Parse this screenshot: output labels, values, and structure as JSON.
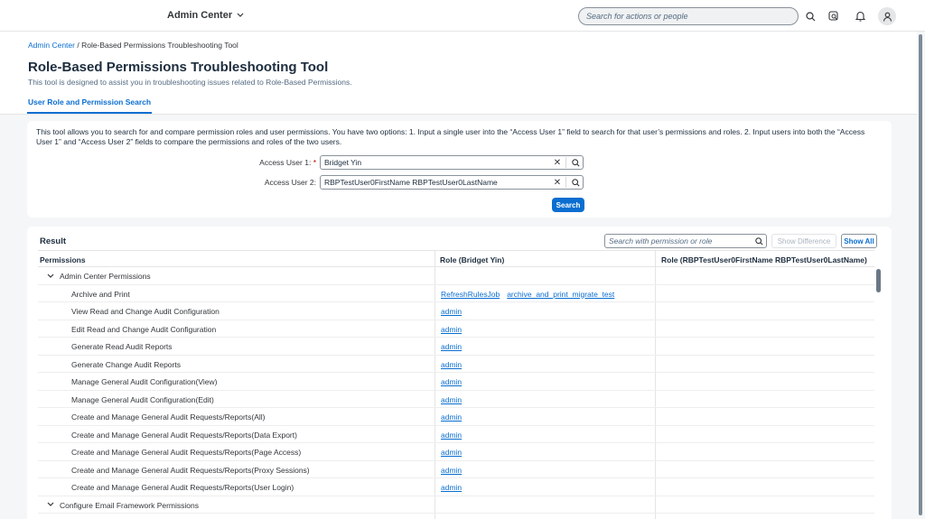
{
  "shell": {
    "title": "Admin Center",
    "search_placeholder": "Search for actions or people"
  },
  "breadcrumb": {
    "root": "Admin Center",
    "current": "Role-Based Permissions Troubleshooting Tool"
  },
  "page": {
    "title": "Role-Based Permissions Troubleshooting Tool",
    "subtitle": "This tool is designed to assist you in troubleshooting issues related to Role-Based Permissions.",
    "tab": "User Role and Permission Search"
  },
  "search_card": {
    "description": "This tool allows you to search for and compare permission roles and user permissions. You have two options: 1. Input a single user into the “Access User 1” field to search for that user’s permissions and roles. 2. Input users into both the “Access User 1” and “Access User 2” fields to compare the permissions and roles of the two users.",
    "user1_label": "Access User 1:",
    "user1_required": "*",
    "user1_value": "Bridget Yin",
    "user2_label": "Access User 2:",
    "user2_value": "RBPTestUser0FirstName RBPTestUser0LastName",
    "search_button": "Search"
  },
  "result": {
    "title": "Result",
    "search_placeholder": "Search with permission or role",
    "show_difference": "Show Difference",
    "show_all": "Show All",
    "columns": [
      "Permissions",
      "Role (Bridget Yin)",
      "Role (RBPTestUser0FirstName RBPTestUser0LastName)"
    ],
    "rows": [
      {
        "type": "group",
        "label": "Admin Center Permissions",
        "roles": []
      },
      {
        "type": "item",
        "label": "Archive and Print",
        "roles": [
          "RefreshRulesJob",
          "archive_and_print_migrate_test"
        ]
      },
      {
        "type": "item",
        "label": "View Read and Change Audit Configuration",
        "roles": [
          "admin"
        ]
      },
      {
        "type": "item",
        "label": "Edit Read and Change Audit Configuration",
        "roles": [
          "admin"
        ]
      },
      {
        "type": "item",
        "label": "Generate Read Audit Reports",
        "roles": [
          "admin"
        ]
      },
      {
        "type": "item",
        "label": "Generate Change Audit Reports",
        "roles": [
          "admin"
        ]
      },
      {
        "type": "item",
        "label": "Manage General Audit Configuration(View)",
        "roles": [
          "admin"
        ]
      },
      {
        "type": "item",
        "label": "Manage General Audit Configuration(Edit)",
        "roles": [
          "admin"
        ]
      },
      {
        "type": "item",
        "label": "Create and Manage General Audit Requests/Reports(All)",
        "roles": [
          "admin"
        ]
      },
      {
        "type": "item",
        "label": "Create and Manage General Audit Requests/Reports(Data Export)",
        "roles": [
          "admin"
        ]
      },
      {
        "type": "item",
        "label": "Create and Manage General Audit Requests/Reports(Page Access)",
        "roles": [
          "admin"
        ]
      },
      {
        "type": "item",
        "label": "Create and Manage General Audit Requests/Reports(Proxy Sessions)",
        "roles": [
          "admin"
        ]
      },
      {
        "type": "item",
        "label": "Create and Manage General Audit Requests/Reports(User Login)",
        "roles": [
          "admin"
        ]
      },
      {
        "type": "group",
        "label": "Configure Email Framework Permissions",
        "roles": []
      }
    ]
  },
  "colors": {
    "accent": "#0a6ed1",
    "required": "#bb0000"
  }
}
